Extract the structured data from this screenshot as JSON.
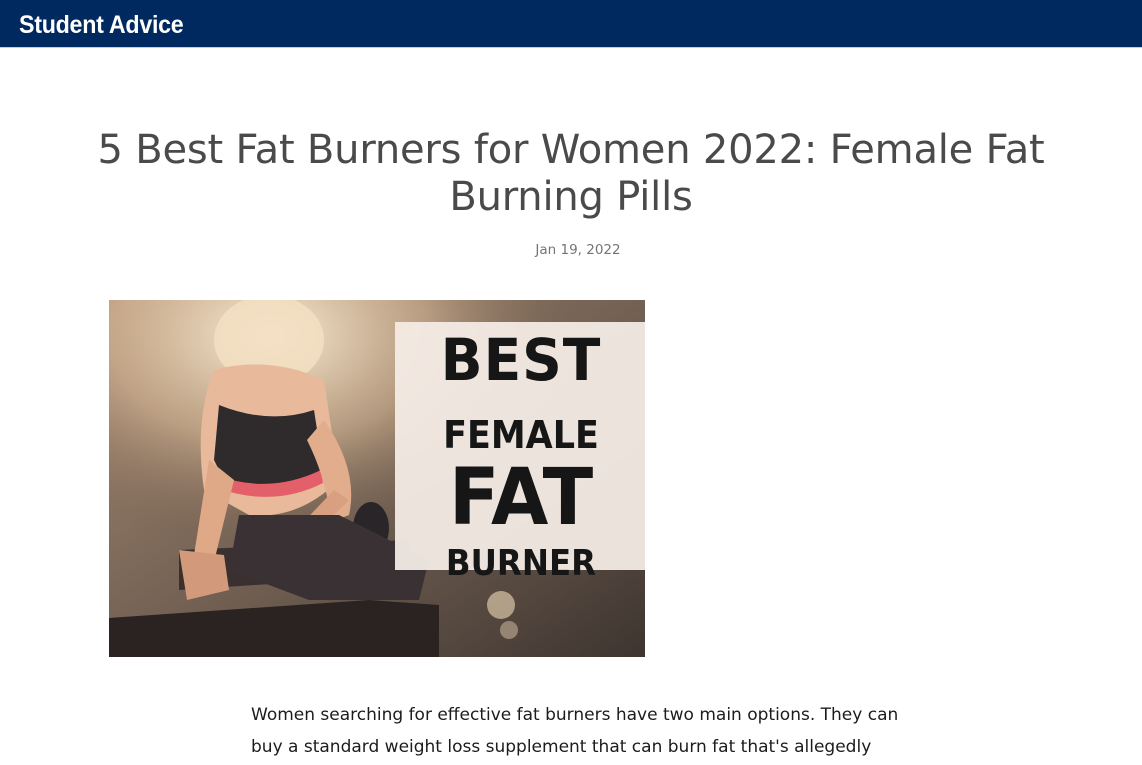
{
  "header": {
    "brand": "Student Advice",
    "brand_color": "#00295f"
  },
  "article": {
    "title": "5 Best Fat Burners for Women 2022: Female Fat Burning Pills",
    "date": "Jan 19, 2022",
    "hero_image": {
      "description_icon": "woman-dumbbell-photo",
      "overlay_lines": [
        "BEST",
        "FEMALE",
        "FAT",
        "BURNER"
      ]
    },
    "intro_paragraph": "Women searching for effective fat burners have two main options. They can buy a standard weight loss supplement that can burn fat that's allegedly"
  }
}
